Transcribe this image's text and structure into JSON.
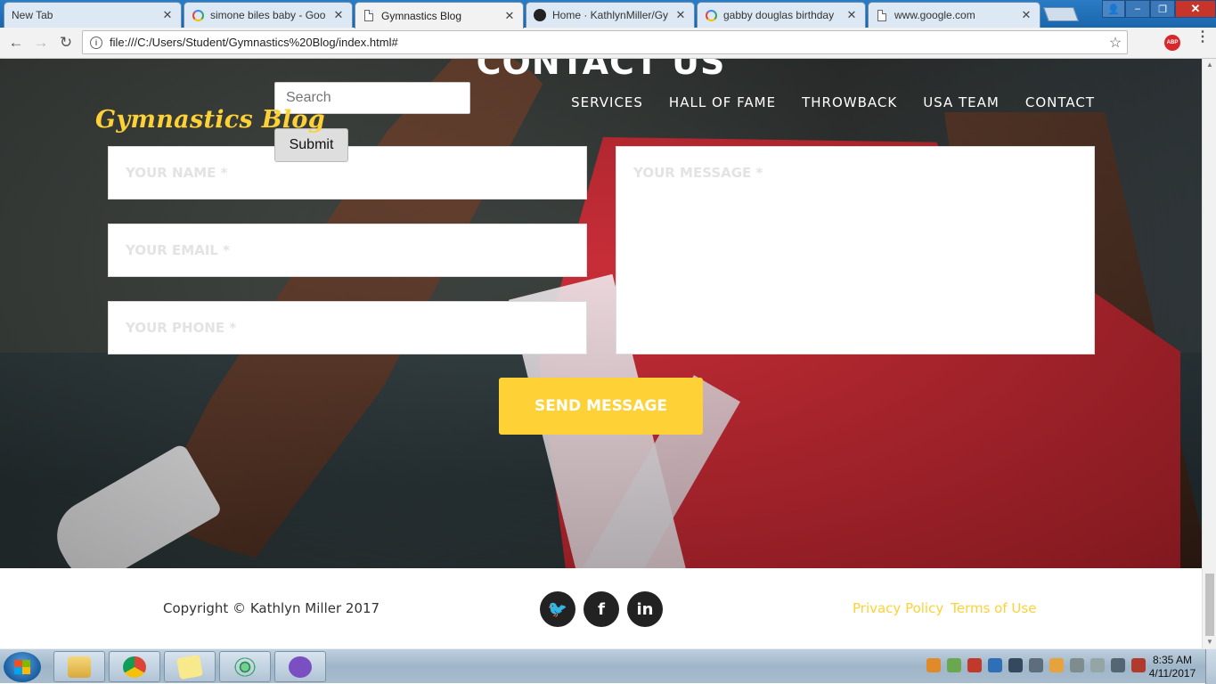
{
  "browser": {
    "tabs": [
      {
        "label": "New Tab",
        "icon": "none"
      },
      {
        "label": "simone biles baby - Goo",
        "icon": "google-icon"
      },
      {
        "label": "Gymnastics Blog",
        "icon": "document-icon",
        "active": true
      },
      {
        "label": "Home · KathlynMiller/Gy",
        "icon": "github-icon"
      },
      {
        "label": "gabby douglas birthday",
        "icon": "google-icon"
      },
      {
        "label": "www.google.com",
        "icon": "document-icon"
      }
    ],
    "close_glyph": "✕",
    "address": "file:///C:/Users/Student/Gymnastics%20Blog/index.html#",
    "nav_glyphs": {
      "back": "←",
      "forward": "→",
      "reload": "↻",
      "star": "☆",
      "menu": "⋮",
      "info": "i"
    },
    "extension_label": "ABP",
    "window_controls": {
      "minimize": "‒",
      "maximize": "❐",
      "close": "✕",
      "user": "👤"
    }
  },
  "page": {
    "section_title": "CONTACT US",
    "search": {
      "placeholder": "Search",
      "button": "Submit"
    },
    "brand": "Gymnastics Blog",
    "nav": [
      "SERVICES",
      "HALL OF FAME",
      "THROWBACK",
      "USA TEAM",
      "CONTACT"
    ],
    "form": {
      "name_placeholder": "YOUR NAME *",
      "email_placeholder": "YOUR EMAIL *",
      "phone_placeholder": "YOUR PHONE *",
      "message_placeholder": "YOUR MESSAGE *",
      "send": "SEND MESSAGE"
    },
    "footer": {
      "copyright": "Copyright © Kathlyn Miller 2017",
      "social": [
        {
          "name": "twitter-icon",
          "glyph": "🐦"
        },
        {
          "name": "facebook-icon",
          "glyph": "f"
        },
        {
          "name": "linkedin-icon",
          "glyph": "in"
        }
      ],
      "privacy": "Privacy Policy",
      "terms": "Terms of Use"
    },
    "accent_color": "#fed136"
  },
  "taskbar": {
    "apps": [
      "file-explorer-icon",
      "chrome-icon",
      "sticky-notes-icon",
      "atom-icon",
      "github-desktop-icon"
    ],
    "time": "8:35 AM",
    "date": "4/11/2017"
  }
}
